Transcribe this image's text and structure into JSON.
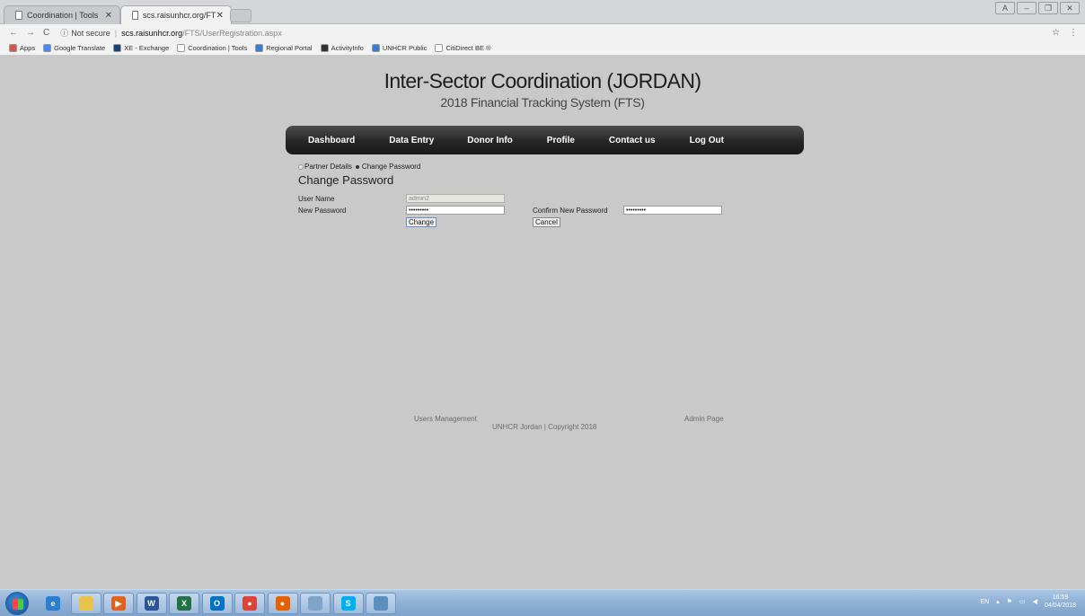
{
  "browser": {
    "tabs": [
      {
        "title": "Coordination | Tools",
        "active": false
      },
      {
        "title": "scs.raisunhcr.org/FTS/Us",
        "active": true
      }
    ],
    "security": "Not secure",
    "url_host": "scs.raisunhcr.org",
    "url_path": "/FTS/UserRegistration.aspx",
    "bookmarks": [
      {
        "label": "Apps",
        "icon": "apps-grid-icon",
        "color": "#d9534f"
      },
      {
        "label": "Google Translate",
        "icon": "google-translate-icon",
        "color": "#4a8af4"
      },
      {
        "label": "XE - Exchange",
        "icon": "xe-icon",
        "color": "#1a3f7a"
      },
      {
        "label": "Coordination | Tools",
        "icon": "page-icon",
        "color": "#ffffff"
      },
      {
        "label": "Regional Portal",
        "icon": "unhcr-icon",
        "color": "#3a7bd5"
      },
      {
        "label": "ActivityInfo",
        "icon": "activityinfo-icon",
        "color": "#333333"
      },
      {
        "label": "UNHCR Public",
        "icon": "unhcr-icon",
        "color": "#3a7bd5"
      },
      {
        "label": "CitiDirect BE ®",
        "icon": "page-icon",
        "color": "#ffffff"
      }
    ]
  },
  "site": {
    "title": "Inter-Sector Coordination (JORDAN)",
    "subtitle": "2018 Financial Tracking System (FTS)"
  },
  "nav": [
    "Dashboard",
    "Data Entry",
    "Donor Info",
    "Profile",
    "Contact us",
    "Log Out"
  ],
  "subtabs": {
    "partner_details": "Partner Details",
    "change_password": "Change Password"
  },
  "form": {
    "heading": "Change Password",
    "user_name_label": "User Name",
    "user_name_value": "admin2",
    "new_password_label": "New Password",
    "new_password_value": "•••••••••",
    "confirm_password_label": "Confirm New Password",
    "confirm_password_value": "•••••••••",
    "change_button": "Change",
    "cancel_button": "Cancel"
  },
  "footer": {
    "users_management": "Users Management",
    "admin_page": "Admin Page",
    "copyright": "UNHCR Jordan | Copyright 2018"
  },
  "taskbar": {
    "apps": [
      {
        "name": "internet-explorer-icon",
        "color": "#2a7fd4",
        "glyph": "e"
      },
      {
        "name": "file-explorer-icon",
        "color": "#e8c24a",
        "glyph": ""
      },
      {
        "name": "media-player-icon",
        "color": "#e0621e",
        "glyph": "▶"
      },
      {
        "name": "word-icon",
        "color": "#2b579a",
        "glyph": "W"
      },
      {
        "name": "excel-icon",
        "color": "#217346",
        "glyph": "X"
      },
      {
        "name": "outlook-icon",
        "color": "#0072c6",
        "glyph": "O"
      },
      {
        "name": "chrome-icon",
        "color": "#db4437",
        "glyph": "●"
      },
      {
        "name": "firefox-icon",
        "color": "#e66000",
        "glyph": "●"
      },
      {
        "name": "notes-icon",
        "color": "#7fa6c9",
        "glyph": ""
      },
      {
        "name": "skype-icon",
        "color": "#00aff0",
        "glyph": "S"
      },
      {
        "name": "snipping-tool-icon",
        "color": "#5a8fc0",
        "glyph": ""
      }
    ],
    "lang": "EN",
    "time": "16:59",
    "date": "04/04/2018"
  }
}
